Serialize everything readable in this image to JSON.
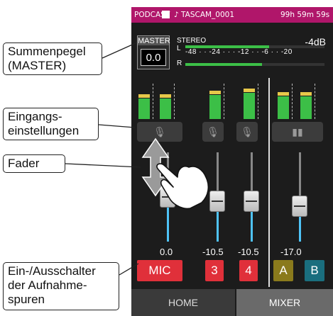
{
  "callouts": {
    "summenpegel": "Summenpegel\n(MASTER)",
    "eingang": "Eingangs-\neinstellungen",
    "fader": "Fader",
    "spuren": "Ein-/Ausschalter\nder Aufnahme-\nspuren"
  },
  "status": {
    "mode": "PODCAST",
    "file": "♪ TASCAM_0001",
    "time": "99h 59m 59s"
  },
  "master": {
    "label": "MASTER",
    "value": "0.0",
    "stereo": "STEREO",
    "level": "-4dB",
    "left": "L",
    "right": "R",
    "scale": "-48 · · -24 · · · -12 · · -6 · · -20",
    "left_fill": 0.6,
    "right_fill": 0.55
  },
  "channels": [
    {
      "value": "0.0",
      "rec": "MIC",
      "rec_color": "#e0303a",
      "meter": 0.62,
      "fader": 0.5,
      "icon": "mic-icon"
    },
    {
      "value": "-10.5",
      "rec": "3",
      "rec_color": "#e0303a",
      "meter": 0.75,
      "fader": 0.45,
      "icon": "mic-icon"
    },
    {
      "value": "-10.5",
      "rec": "4",
      "rec_color": "#e0303a",
      "meter": 0.8,
      "fader": 0.45,
      "icon": "mic-icon"
    },
    {
      "value": "-17.0",
      "rec_a": "A",
      "rec_b": "B",
      "rec_a_color": "#8a7a1c",
      "rec_b_color": "#1a6e7e",
      "meter": 0.7,
      "fader": 0.4,
      "icon": "pad-icon"
    }
  ],
  "tabs": {
    "home": "HOME",
    "mixer": "MIXER"
  }
}
